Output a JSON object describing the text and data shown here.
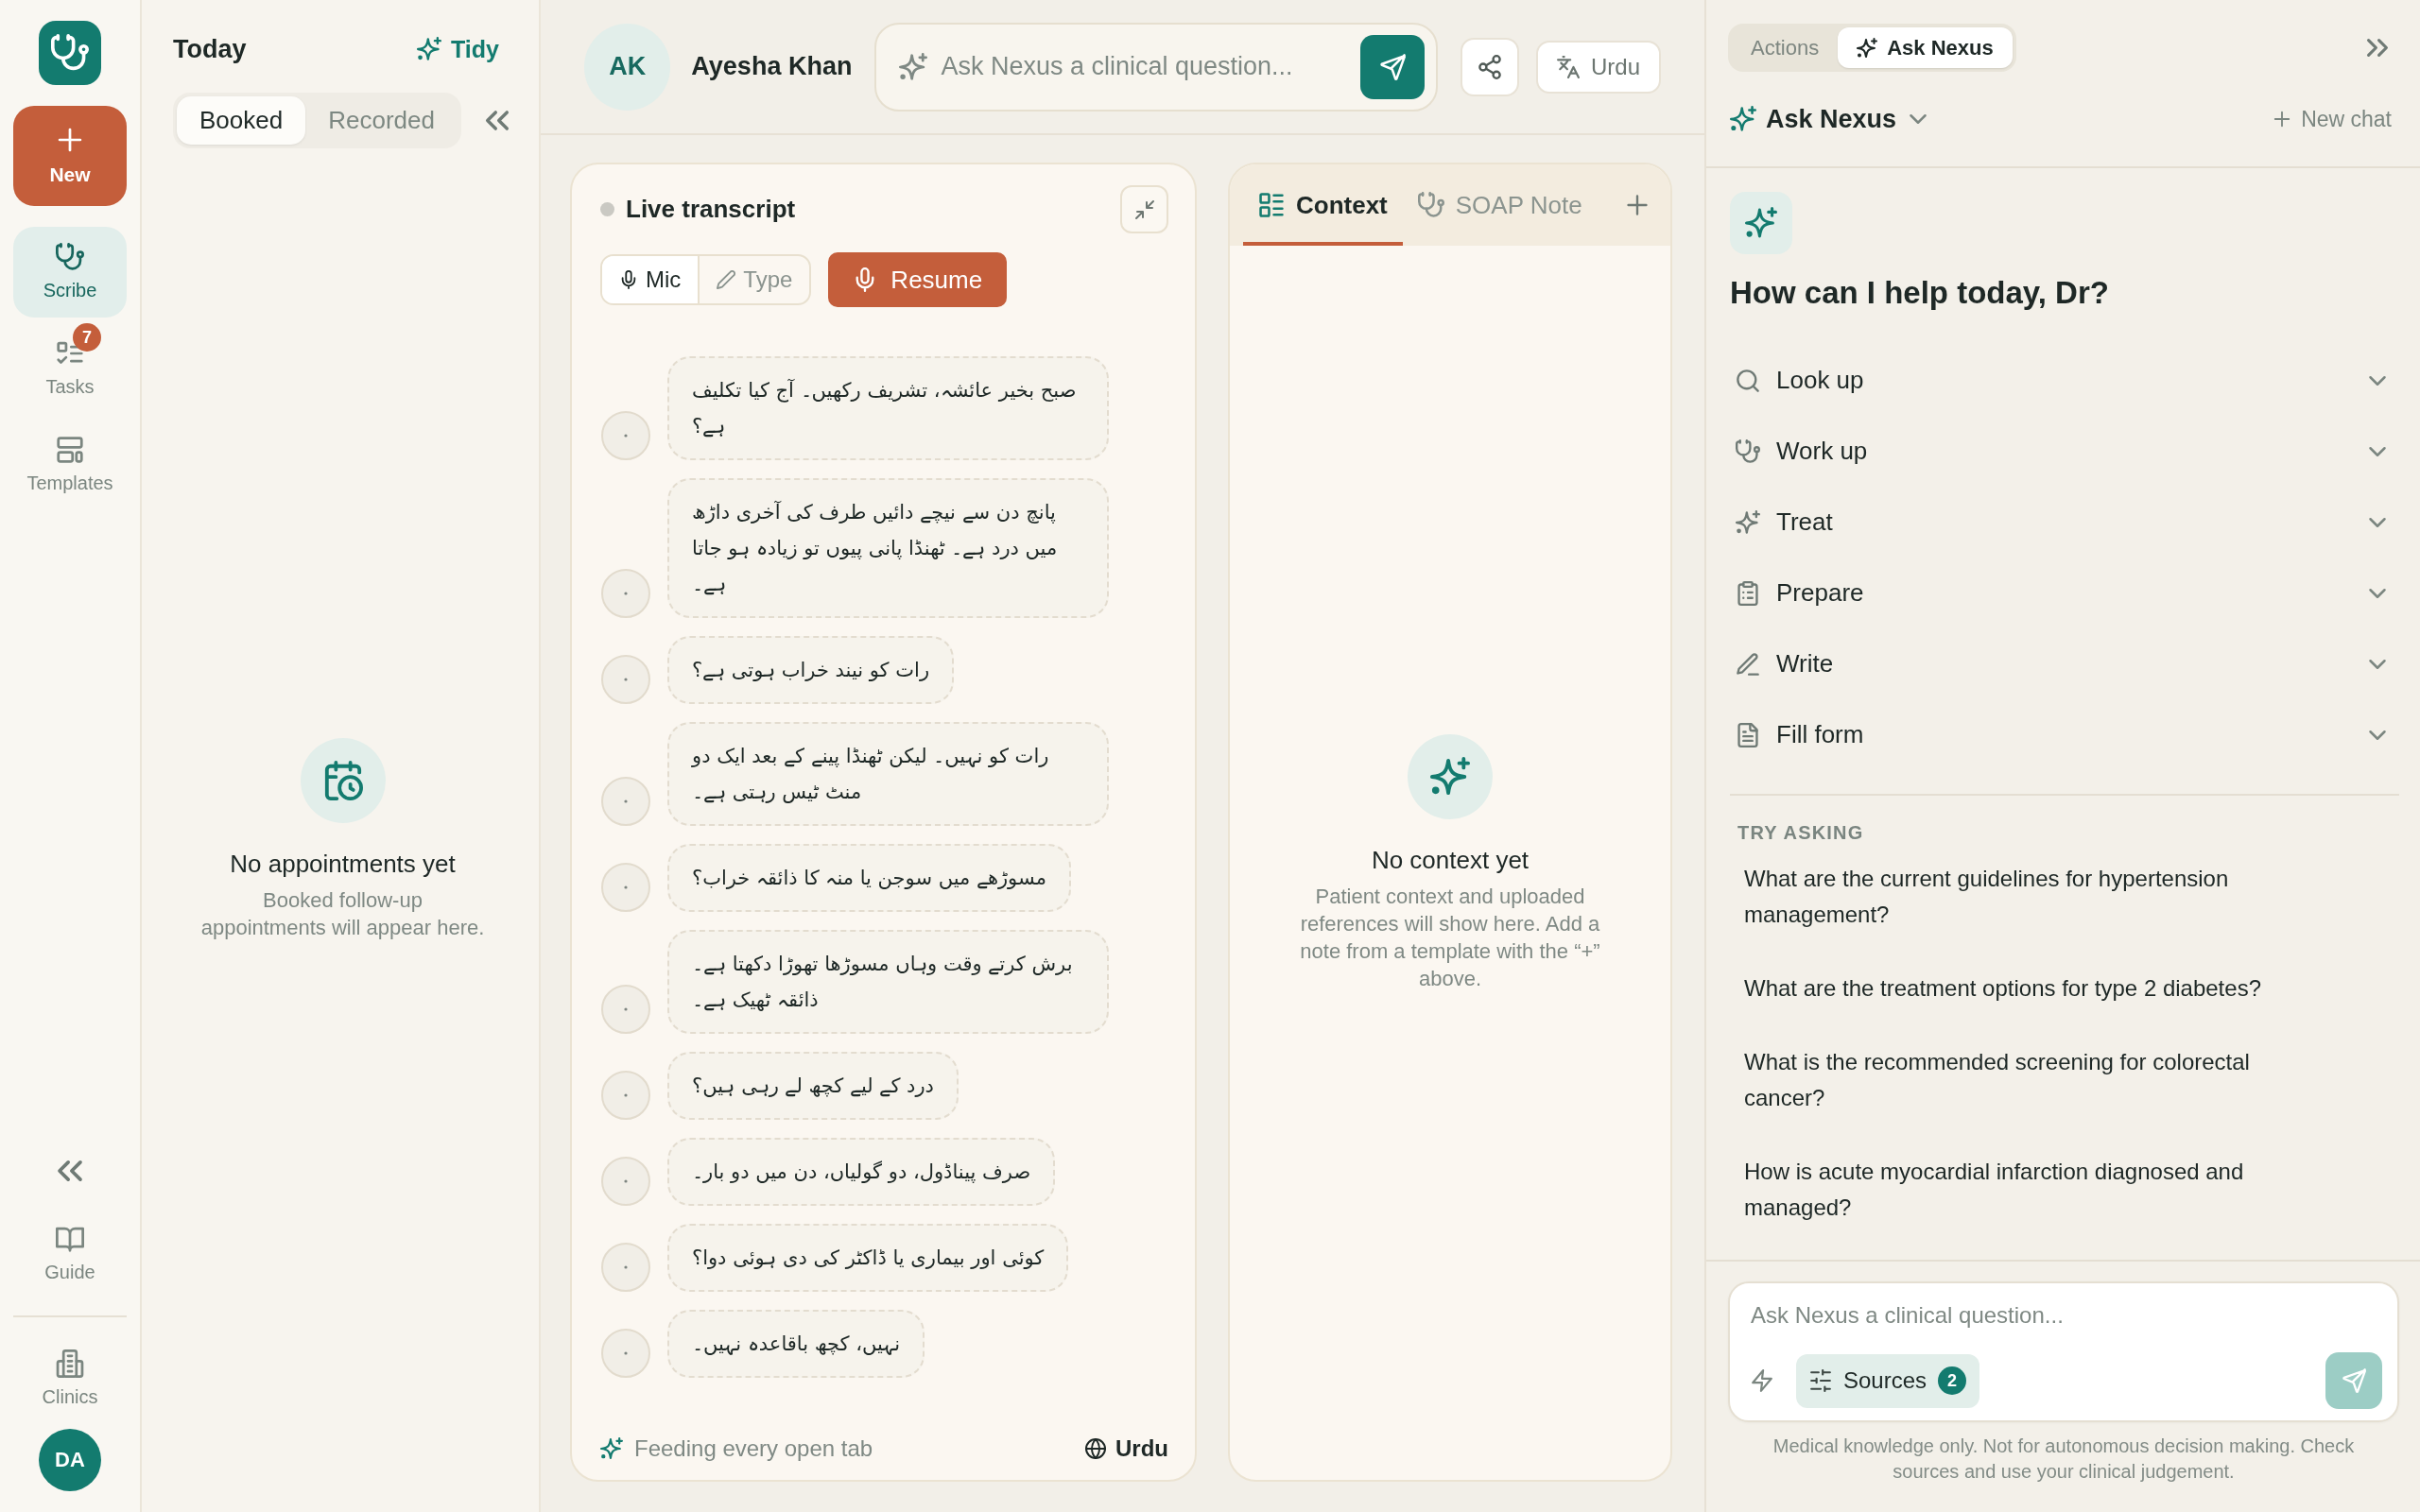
{
  "rail": {
    "new_button": "New",
    "nav": [
      {
        "label": "Scribe",
        "selected": true
      },
      {
        "label": "Tasks",
        "selected": false,
        "badge": "7"
      },
      {
        "label": "Templates",
        "selected": false
      }
    ],
    "footer_items": [
      {
        "label": "Guide"
      },
      {
        "label": "Clinics"
      }
    ],
    "user_initials": "DA"
  },
  "today": {
    "title": "Today",
    "tidy_button": "Tidy",
    "tabs": [
      {
        "label": "Booked",
        "selected": true
      },
      {
        "label": "Recorded",
        "selected": false
      }
    ],
    "empty_state": {
      "title": "No appointments yet",
      "description": "Booked follow-up appointments will appear here."
    }
  },
  "header": {
    "patient": {
      "initials": "AK",
      "name": "Ayesha Khan"
    },
    "ask_field": {
      "placeholder": "Ask Nexus a clinical question..."
    },
    "language_button": "Urdu"
  },
  "transcript": {
    "title": "Live transcript",
    "live": false,
    "modes": [
      {
        "label": "Mic",
        "selected": true
      },
      {
        "label": "Type",
        "selected": false
      }
    ],
    "resume_button": "Resume",
    "messages": [
      {
        "text": "صبح بخیر عائشہ، تشریف رکھیں۔ آج کیا تکلیف ہے؟"
      },
      {
        "text": "پانچ دن سے نیچے دائیں طرف کی آخری داڑھ میں درد ہے۔ ٹھنڈا پانی پیوں تو زیادہ ہو جاتا ہے۔"
      },
      {
        "text": "رات کو نیند خراب ہوتی ہے؟"
      },
      {
        "text": "رات کو نہیں۔ لیکن ٹھنڈا پینے کے بعد ایک دو منٹ ٹیس رہتی ہے۔"
      },
      {
        "text": "مسوڑھے میں سوجن یا منہ کا ذائقہ خراب؟"
      },
      {
        "text": "برش کرتے وقت وہاں مسوڑھا تھوڑا دکھتا ہے۔ ذائقہ ٹھیک ہے۔"
      },
      {
        "text": "درد کے لیے کچھ لے رہی ہیں؟"
      },
      {
        "text": "صرف پیناڈول، دو گولیاں، دن میں دو بار۔"
      },
      {
        "text": "کوئی اور بیماری یا ڈاکٹر کی دی ہوئی دوا؟"
      },
      {
        "text": "نہیں، کچھ باقاعدہ نہیں۔"
      }
    ],
    "footer": {
      "status": "Feeding every open tab",
      "language": "Urdu"
    }
  },
  "context": {
    "tabs": [
      {
        "label": "Context",
        "selected": true
      },
      {
        "label": "SOAP Note",
        "selected": false
      }
    ],
    "empty_state": {
      "title": "No context yet",
      "description": "Patient context and uploaded references will show here. Add a note from a template with the “+” above."
    }
  },
  "assistant": {
    "tabs": [
      {
        "label": "Actions",
        "selected": false
      },
      {
        "label": "Ask Nexus",
        "selected": true
      }
    ],
    "mode_selector": "Ask Nexus",
    "new_chat_button": "New chat",
    "greeting": "How can I help today, Dr?",
    "actions": [
      {
        "label": "Look up",
        "expanded": false
      },
      {
        "label": "Work up",
        "expanded": false
      },
      {
        "label": "Treat",
        "expanded": false
      },
      {
        "label": "Prepare",
        "expanded": false
      },
      {
        "label": "Write",
        "expanded": false
      },
      {
        "label": "Fill form",
        "expanded": false
      }
    ],
    "try_asking": {
      "heading": "TRY ASKING",
      "questions": [
        "What are the current guidelines for hypertension management?",
        "What are the treatment options for type 2 diabetes?",
        "What is the recommended screening for colorectal cancer?",
        "How is acute myocardial infarction diagnosed and managed?"
      ]
    },
    "composer": {
      "placeholder": "Ask Nexus a clinical question...",
      "sources": {
        "label": "Sources",
        "count": "2"
      }
    },
    "disclaimer": "Medical knowledge only. Not for autonomous decision making. Check sources and use your clinical judgement."
  }
}
